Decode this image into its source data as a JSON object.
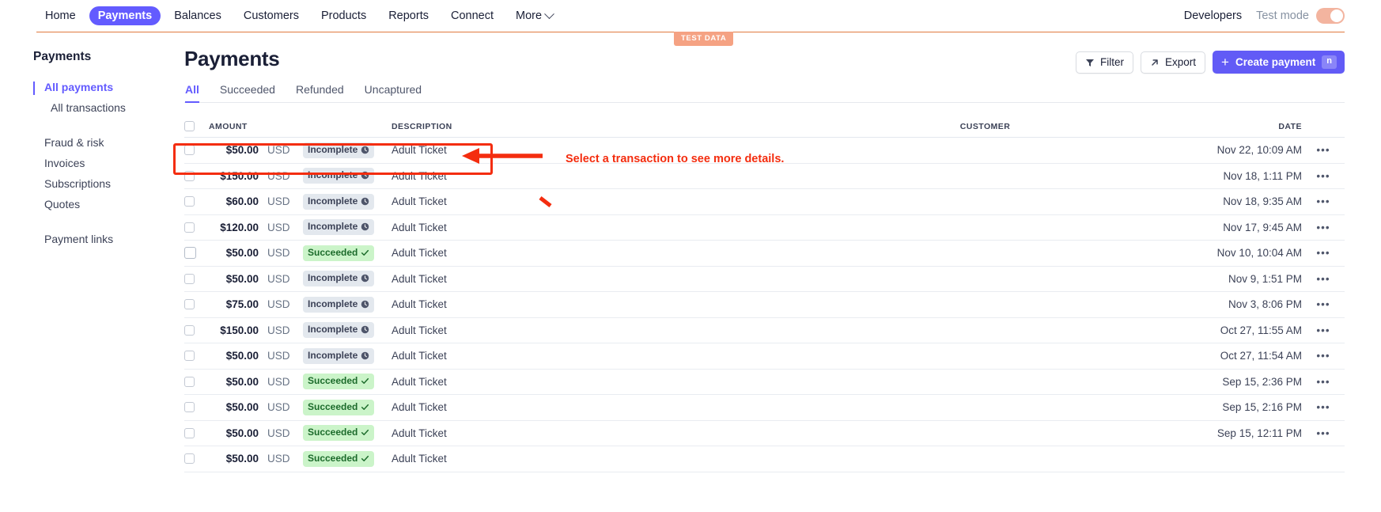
{
  "topnav": {
    "items": [
      {
        "label": "Home",
        "active": false
      },
      {
        "label": "Payments",
        "active": true
      },
      {
        "label": "Balances",
        "active": false
      },
      {
        "label": "Customers",
        "active": false
      },
      {
        "label": "Products",
        "active": false
      },
      {
        "label": "Reports",
        "active": false
      },
      {
        "label": "Connect",
        "active": false
      },
      {
        "label": "More",
        "active": false
      }
    ],
    "developers_label": "Developers",
    "test_mode_label": "Test mode",
    "test_mode_on": true,
    "test_data_badge": "TEST DATA"
  },
  "sidebar": {
    "title": "Payments",
    "items": [
      {
        "label": "All payments",
        "active": true,
        "sub": false
      },
      {
        "label": "All transactions",
        "active": false,
        "sub": true
      },
      {
        "label": "Fraud & risk",
        "active": false,
        "sub": false
      },
      {
        "label": "Invoices",
        "active": false,
        "sub": false
      },
      {
        "label": "Subscriptions",
        "active": false,
        "sub": false
      },
      {
        "label": "Quotes",
        "active": false,
        "sub": false
      },
      {
        "label": "Payment links",
        "active": false,
        "sub": false
      }
    ]
  },
  "main": {
    "title": "Payments",
    "buttons": {
      "filter": "Filter",
      "export": "Export",
      "create_payment": "Create payment",
      "create_payment_shortcut": "n"
    },
    "tabs": [
      {
        "label": "All",
        "active": true
      },
      {
        "label": "Succeeded",
        "active": false
      },
      {
        "label": "Refunded",
        "active": false
      },
      {
        "label": "Uncaptured",
        "active": false
      }
    ]
  },
  "table": {
    "columns": {
      "amount": "AMOUNT",
      "description": "DESCRIPTION",
      "customer": "CUSTOMER",
      "date": "DATE"
    },
    "more_glyph": "•••",
    "rows": [
      {
        "amount": "$50.00",
        "currency": "USD",
        "status": "Incomplete",
        "status_kind": "incomplete",
        "description": "Adult Ticket",
        "customer": "",
        "date": "Nov 22, 10:09 AM",
        "highlighted": true
      },
      {
        "amount": "$150.00",
        "currency": "USD",
        "status": "Incomplete",
        "status_kind": "incomplete",
        "description": "Adult Ticket",
        "customer": "",
        "date": "Nov 18, 1:11 PM",
        "highlighted": false
      },
      {
        "amount": "$60.00",
        "currency": "USD",
        "status": "Incomplete",
        "status_kind": "incomplete",
        "description": "Adult Ticket",
        "customer": "",
        "date": "Nov 18, 9:35 AM",
        "highlighted": false
      },
      {
        "amount": "$120.00",
        "currency": "USD",
        "status": "Incomplete",
        "status_kind": "incomplete",
        "description": "Adult Ticket",
        "customer": "",
        "date": "Nov 17, 9:45 AM",
        "highlighted": false
      },
      {
        "amount": "$50.00",
        "currency": "USD",
        "status": "Succeeded",
        "status_kind": "succeeded",
        "description": "Adult Ticket",
        "customer": "",
        "date": "Nov 10, 10:04 AM",
        "highlighted": false
      },
      {
        "amount": "$50.00",
        "currency": "USD",
        "status": "Incomplete",
        "status_kind": "incomplete",
        "description": "Adult Ticket",
        "customer": "",
        "date": "Nov 9, 1:51 PM",
        "highlighted": false
      },
      {
        "amount": "$75.00",
        "currency": "USD",
        "status": "Incomplete",
        "status_kind": "incomplete",
        "description": "Adult Ticket",
        "customer": "",
        "date": "Nov 3, 8:06 PM",
        "highlighted": false
      },
      {
        "amount": "$150.00",
        "currency": "USD",
        "status": "Incomplete",
        "status_kind": "incomplete",
        "description": "Adult Ticket",
        "customer": "",
        "date": "Oct 27, 11:55 AM",
        "highlighted": false
      },
      {
        "amount": "$50.00",
        "currency": "USD",
        "status": "Incomplete",
        "status_kind": "incomplete",
        "description": "Adult Ticket",
        "customer": "",
        "date": "Oct 27, 11:54 AM",
        "highlighted": false
      },
      {
        "amount": "$50.00",
        "currency": "USD",
        "status": "Succeeded",
        "status_kind": "succeeded",
        "description": "Adult Ticket",
        "customer": "",
        "date": "Sep 15, 2:36 PM",
        "highlighted": false
      },
      {
        "amount": "$50.00",
        "currency": "USD",
        "status": "Succeeded",
        "status_kind": "succeeded",
        "description": "Adult Ticket",
        "customer": "",
        "date": "Sep 15, 2:16 PM",
        "highlighted": false
      },
      {
        "amount": "$50.00",
        "currency": "USD",
        "status": "Succeeded",
        "status_kind": "succeeded",
        "description": "Adult Ticket",
        "customer": "",
        "date": "Sep 15, 12:11 PM",
        "highlighted": false
      },
      {
        "amount": "$50.00",
        "currency": "USD",
        "status": "Succeeded",
        "status_kind": "succeeded",
        "description": "Adult Ticket",
        "customer": "",
        "date": "",
        "highlighted": false
      }
    ]
  },
  "annotations": {
    "callout_text": "Select a transaction to see more details.",
    "color": "#f42d0f"
  }
}
